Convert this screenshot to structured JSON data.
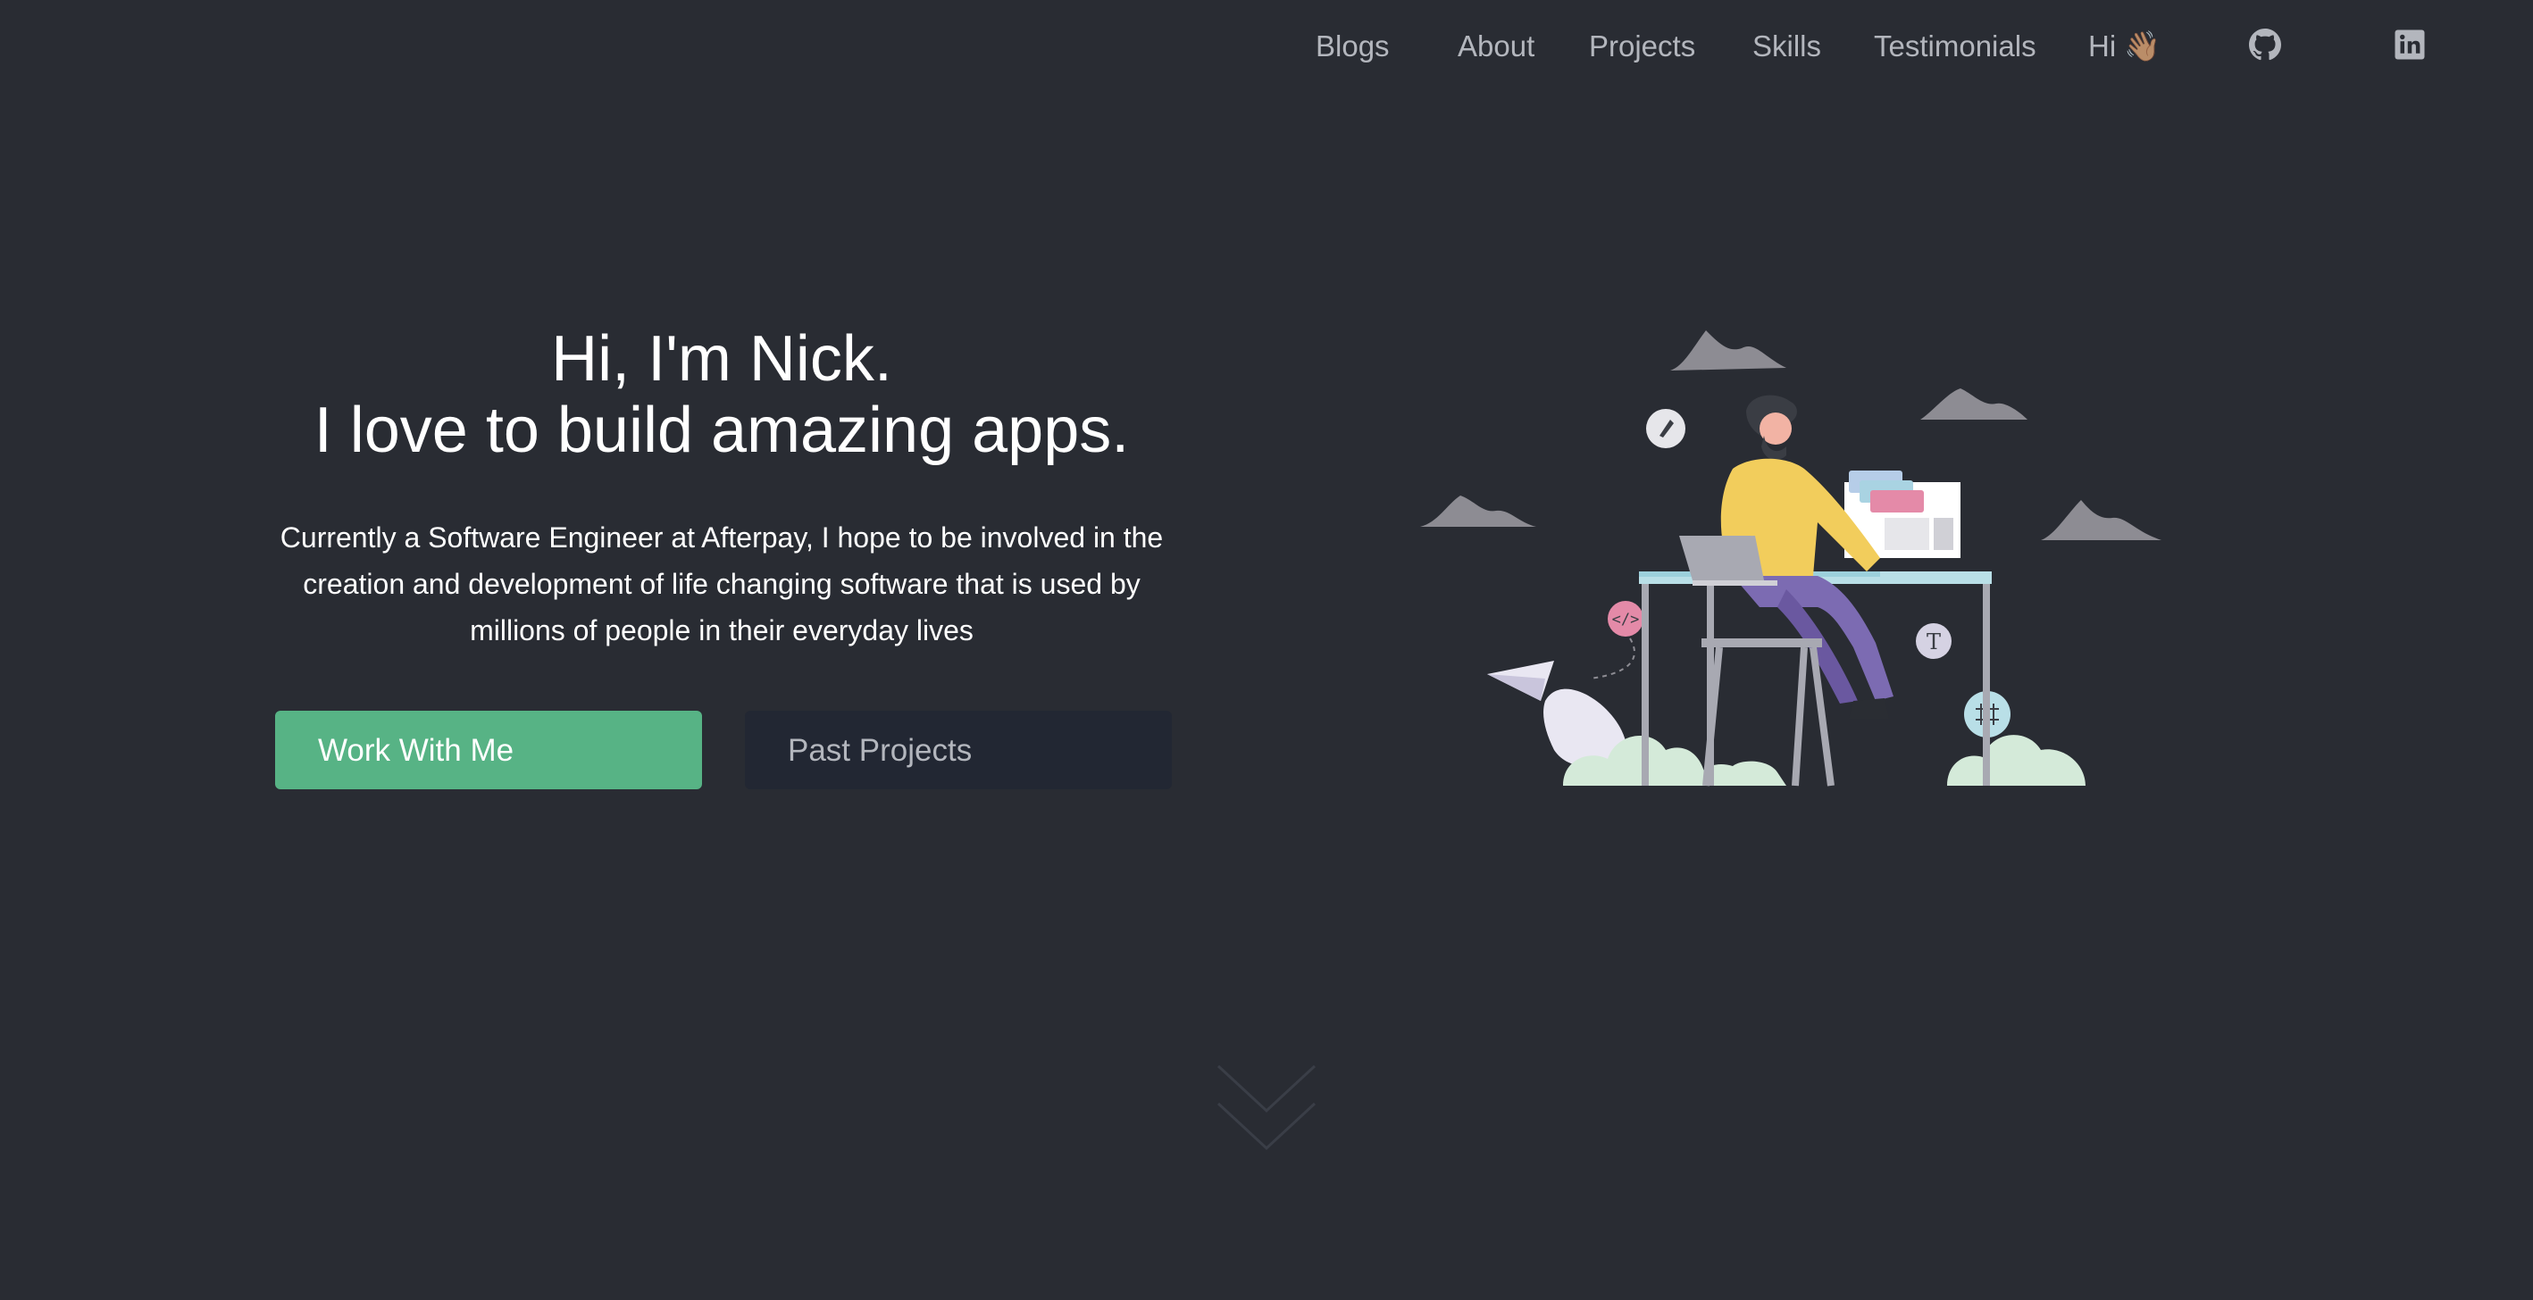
{
  "nav": {
    "links": [
      {
        "label": "Blogs"
      },
      {
        "label": "About"
      },
      {
        "label": "Projects"
      },
      {
        "label": "Skills"
      },
      {
        "label": "Testimonials"
      },
      {
        "label": "Hi 👋🏽"
      }
    ],
    "social": [
      {
        "icon": "github-icon"
      },
      {
        "icon": "linkedin-icon"
      }
    ]
  },
  "hero": {
    "title_line1": "Hi, I'm Nick.",
    "title_line2": "I love to build amazing apps.",
    "description": "Currently a Software Engineer at Afterpay, I hope to be involved in the creation and development of life changing software that is used by millions of people in their everyday lives",
    "primary_button": "Work With Me",
    "secondary_button": "Past Projects"
  },
  "colors": {
    "background": "#292c33",
    "accent": "#57b385",
    "secondary_button_bg": "#222733",
    "nav_text": "#b3b6bd"
  }
}
